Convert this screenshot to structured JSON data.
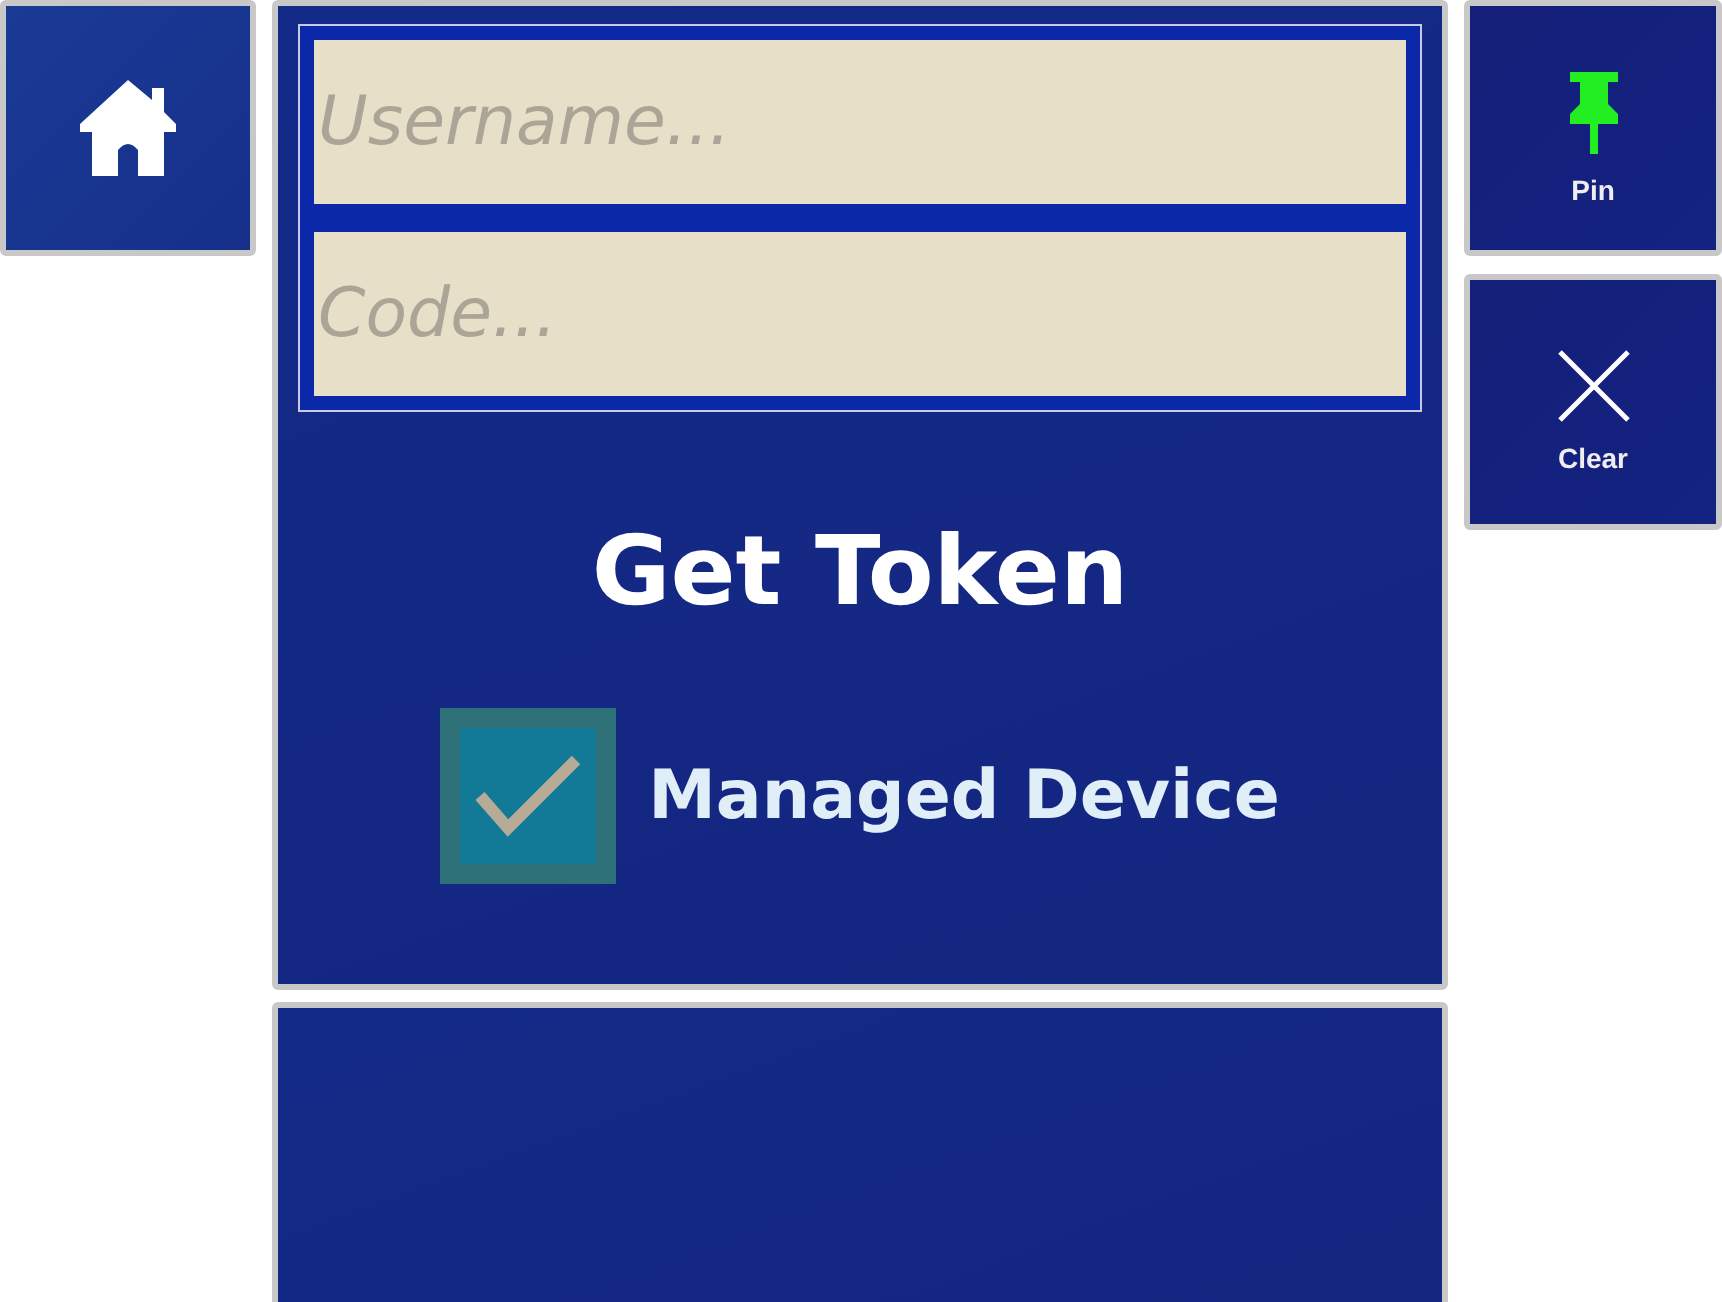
{
  "home_button": {
    "kind": "home"
  },
  "form": {
    "fields": [
      {
        "placeholder": "Username..."
      },
      {
        "placeholder": "Code..."
      }
    ],
    "submit": {
      "label": "Get Token"
    },
    "managed_device": {
      "label": "Managed Device",
      "checked": true
    }
  },
  "side_buttons": [
    {
      "kind": "pin",
      "label": "Pin"
    },
    {
      "kind": "clear",
      "label": "Clear"
    }
  ]
}
